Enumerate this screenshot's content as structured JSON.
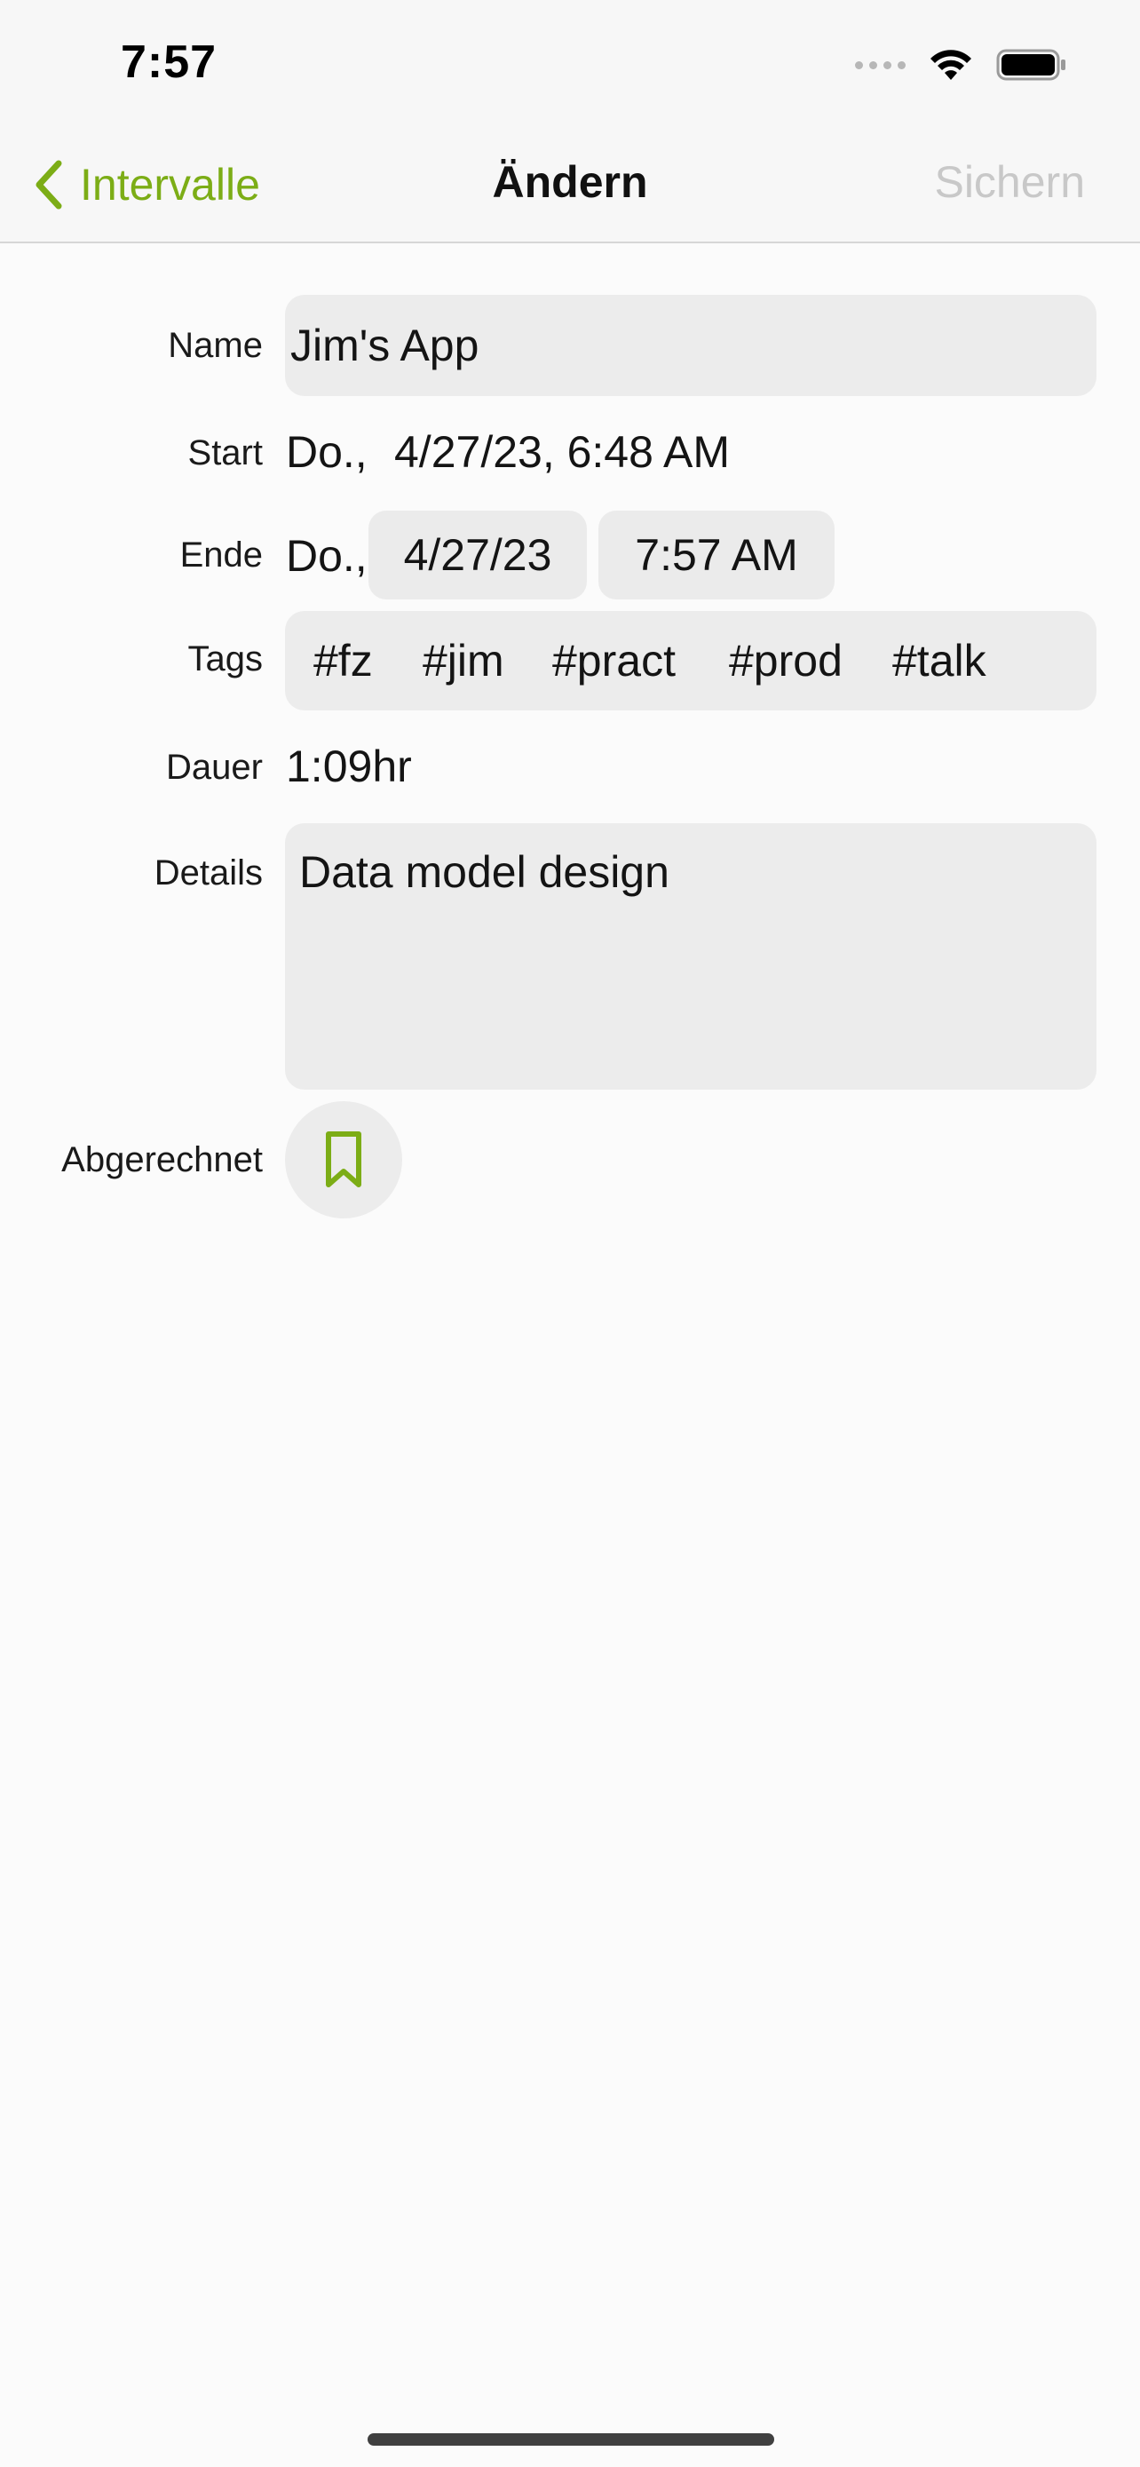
{
  "status_bar": {
    "time": "7:57"
  },
  "nav": {
    "back_label": "Intervalle",
    "title": "Ändern",
    "save_label": "Sichern",
    "accent_color": "#7cad16",
    "disabled_color": "#c8c8c8"
  },
  "form": {
    "name": {
      "label": "Name",
      "value": "Jim's App"
    },
    "start": {
      "label": "Start",
      "weekday": "Do.,",
      "datetime": "4/27/23, 6:48 AM"
    },
    "end": {
      "label": "Ende",
      "weekday": "Do.,",
      "date": "4/27/23",
      "time": "7:57 AM"
    },
    "tags": {
      "label": "Tags",
      "items": [
        "#fz",
        "#jim",
        "#pract",
        "#prod",
        "#talk"
      ]
    },
    "duration": {
      "label": "Dauer",
      "value": "1:09hr"
    },
    "details": {
      "label": "Details",
      "value": "Data model design"
    },
    "billed": {
      "label": "Abgerechnet",
      "icon": "bookmark-icon",
      "checked": false
    }
  }
}
